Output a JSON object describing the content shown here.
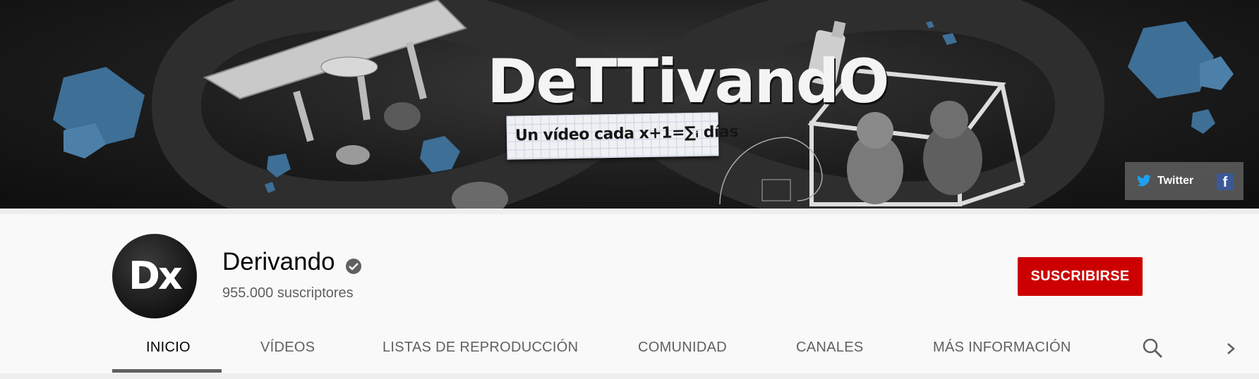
{
  "banner": {
    "logo_text": "DeTTivandO",
    "tagline": "Un vídeo cada x+1=∑ᵢ días",
    "social": {
      "twitter_label": "Twitter",
      "twitter_icon": "twitter-bird-icon",
      "facebook_icon": "facebook-icon",
      "facebook_glyph": "f"
    }
  },
  "channel": {
    "avatar_text": "Dx",
    "name": "Derivando",
    "verified_icon": "verified-check-icon",
    "subscribers": "955.000 suscriptores",
    "subscribe_label": "SUSCRIBIRSE"
  },
  "tabs": [
    {
      "label": "INICIO",
      "active": true
    },
    {
      "label": "VÍDEOS",
      "active": false
    },
    {
      "label": "LISTAS DE REPRODUCCIÓN",
      "active": false
    },
    {
      "label": "COMUNIDAD",
      "active": false
    },
    {
      "label": "CANALES",
      "active": false
    },
    {
      "label": "MÁS INFORMACIÓN",
      "active": false
    }
  ],
  "icons": {
    "search": "search-icon",
    "next": "chevron-right-icon"
  },
  "colors": {
    "subscribe_bg": "#cc0000",
    "banner_bg": "#1c1c1c",
    "facebook": "#3b5998",
    "twitter": "#1da1f2",
    "cube_blue": "#3e6f96"
  }
}
